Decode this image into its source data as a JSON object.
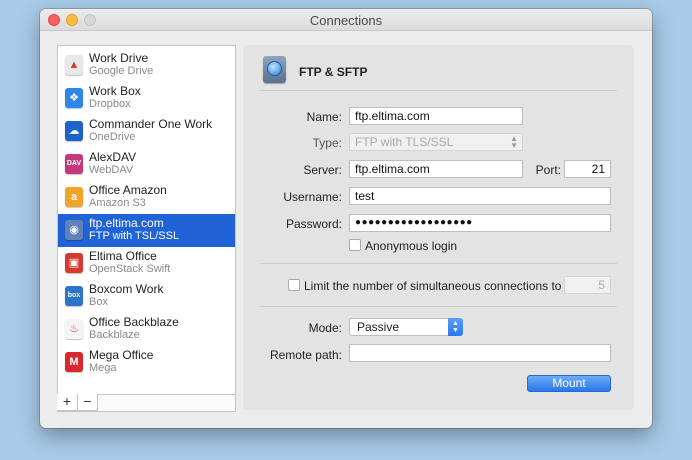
{
  "window": {
    "title": "Connections"
  },
  "sidebar": {
    "items": [
      {
        "name": "Work Drive",
        "type": "Google Drive",
        "icon": "google-drive-icon",
        "icon_color": "#e8e8e8",
        "icon_glyph": "▲"
      },
      {
        "name": "Work Box",
        "type": "Dropbox",
        "icon": "dropbox-icon",
        "icon_color": "#2f86e6",
        "icon_glyph": "❖"
      },
      {
        "name": "Commander One Work",
        "type": "OneDrive",
        "icon": "onedrive-icon",
        "icon_color": "#1f63c8",
        "icon_glyph": "☁"
      },
      {
        "name": "AlexDAV",
        "type": "WebDAV",
        "icon": "webdav-icon",
        "icon_color": "#c23a7a",
        "icon_glyph": "DAV"
      },
      {
        "name": "Office Amazon",
        "type": "Amazon S3",
        "icon": "amazon-s3-icon",
        "icon_color": "#f0a52a",
        "icon_glyph": "a"
      },
      {
        "name": "ftp.eltima.com",
        "type": "FTP with TSL/SSL",
        "icon": "ftp-globe-icon",
        "icon_color": "#5f82b8",
        "icon_glyph": "◉",
        "selected": true
      },
      {
        "name": "Eltima Office",
        "type": "OpenStack Swift",
        "icon": "openstack-icon",
        "icon_color": "#d53a2e",
        "icon_glyph": "▣"
      },
      {
        "name": "Boxcom Work",
        "type": "Box",
        "icon": "box-icon",
        "icon_color": "#2b74c9",
        "icon_glyph": "box"
      },
      {
        "name": "Office Backblaze",
        "type": "Backblaze",
        "icon": "backblaze-icon",
        "icon_color": "#f4f4f4",
        "icon_glyph": "♨"
      },
      {
        "name": "Mega Office",
        "type": "Mega",
        "icon": "mega-icon",
        "icon_color": "#d9272e",
        "icon_glyph": "M"
      }
    ],
    "add_label": "+",
    "remove_label": "−"
  },
  "panel": {
    "header_title": "FTP & SFTP",
    "name_label": "Name:",
    "name_value": "ftp.eltima.com",
    "type_label": "Type:",
    "type_value": "FTP with TLS/SSL",
    "server_label": "Server:",
    "server_value": "ftp.eltima.com",
    "port_label": "Port:",
    "port_value": "21",
    "username_label": "Username:",
    "username_value": "test",
    "password_label": "Password:",
    "password_value": "●●●●●●●●●●●●●●●●●●",
    "anonymous_label": "Anonymous login",
    "limit_label": "Limit the number of simultaneous connections to",
    "limit_value": "5",
    "mode_label": "Mode:",
    "mode_value": "Passive",
    "remote_path_label": "Remote path:",
    "remote_path_value": "",
    "mount_label": "Mount"
  },
  "colors": {
    "selection": "#1f63d6",
    "accent_button": "#2a78ea",
    "desktop": "#a9cbe8"
  }
}
